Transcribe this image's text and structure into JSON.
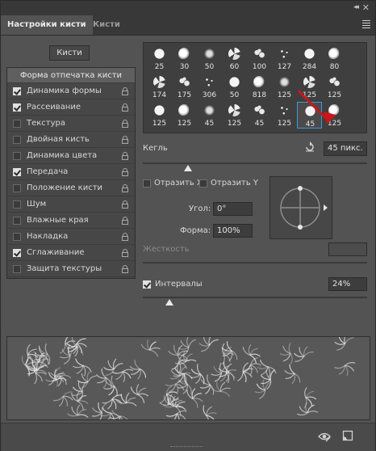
{
  "window": {
    "collapse_glyph": "◂◂",
    "close_glyph": "✕"
  },
  "tabs": [
    {
      "label": "Настройки кисти",
      "active": true
    },
    {
      "label": "Кисти",
      "active": false
    }
  ],
  "brushes_button": "Кисти",
  "settings_list": {
    "header": "Форма отпечатка кисти",
    "items": [
      {
        "label": "Динамика формы",
        "checked": true
      },
      {
        "label": "Рассеивание",
        "checked": true
      },
      {
        "label": "Текстура",
        "checked": false
      },
      {
        "label": "Двойная кисть",
        "checked": false
      },
      {
        "label": "Динамика цвета",
        "checked": false
      },
      {
        "label": "Передача",
        "checked": true
      },
      {
        "label": "Положение кисти",
        "checked": false
      },
      {
        "label": "Шум",
        "checked": false
      },
      {
        "label": "Влажные края",
        "checked": false
      },
      {
        "label": "Накладка",
        "checked": false
      },
      {
        "label": "Сглаживание",
        "checked": true
      },
      {
        "label": "Защита текстуры",
        "checked": false
      }
    ]
  },
  "brush_tips": [
    [
      "25",
      "30",
      "50",
      "60",
      "100",
      "127",
      "284",
      "80"
    ],
    [
      "174",
      "175",
      "306",
      "50",
      "818",
      "125",
      "125",
      "125"
    ],
    [
      "125",
      "125",
      "45",
      "125",
      "45",
      "125",
      "45",
      "125"
    ]
  ],
  "selected_tip_index": 22,
  "size": {
    "label": "Кегль",
    "value": "45 пикс.",
    "slider_fraction": 0.2
  },
  "flip": {
    "flip_x_label": "Отразить X",
    "flip_y_label": "Отразить Y",
    "flip_x": false,
    "flip_y": false
  },
  "angle": {
    "label": "Угол:",
    "value": "0°"
  },
  "roundness": {
    "label": "Форма:",
    "value": "100%"
  },
  "hardness": {
    "label": "Жесткость",
    "value": ""
  },
  "spacing": {
    "label": "Интервалы",
    "checked": true,
    "value": "24%",
    "slider_fraction": 0.12
  },
  "colors": {
    "panel": "#535353",
    "highlight": "#3d9ad6",
    "annotation_arrow": "#c8161d"
  }
}
